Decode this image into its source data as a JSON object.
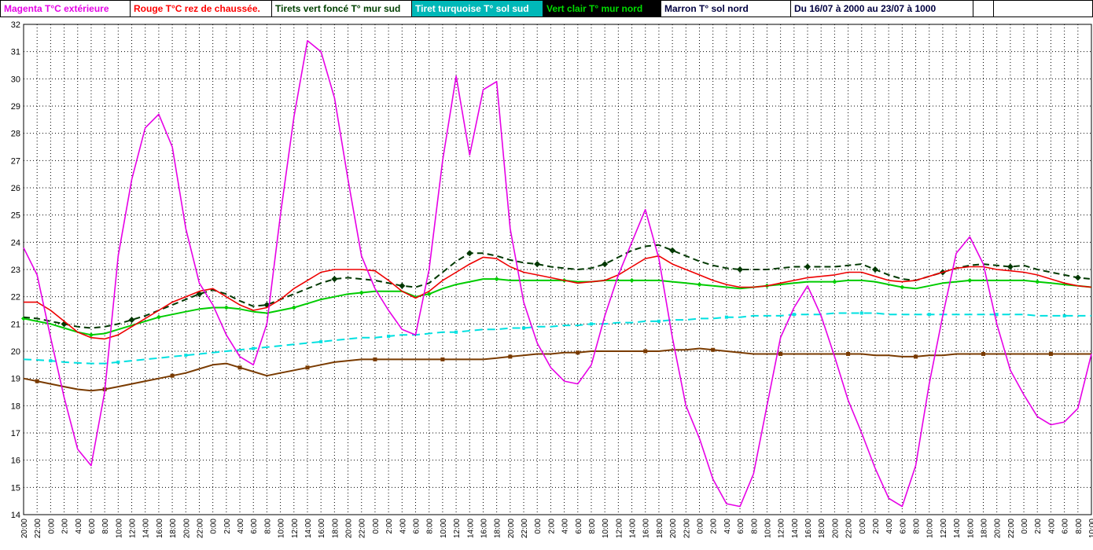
{
  "header": {
    "legend": [
      {
        "label": "Magenta T°C extérieure",
        "color": "#e600e6",
        "bg": "#ffffff"
      },
      {
        "label": "Rouge T°C rez de chaussée.",
        "color": "#ff0000",
        "bg": "#ffffff"
      },
      {
        "label": "Tirets vert foncé T° mur sud",
        "color": "#004000",
        "bg": "#ffffff"
      },
      {
        "label": "Tiret turquoise T° sol sud",
        "color": "#ffffff",
        "bg": "#00b8b8"
      },
      {
        "label": "Vert clair T° mur nord",
        "color": "#00dd00",
        "bg": "#000000"
      },
      {
        "label": "Marron T° sol nord",
        "color": "#000040",
        "bg": "#ffffff"
      }
    ],
    "date_range": "Du 16/07 à 2000 au 23/07 à 1000"
  },
  "chart_data": {
    "type": "line",
    "title": "",
    "xlabel": "",
    "ylabel": "",
    "ylim": [
      14,
      32
    ],
    "y_tick_step": 1,
    "grid": true,
    "plot_bg": "#ffffff",
    "grid_color": "#000000",
    "x_tick_labels": [
      "20:00",
      "22:00",
      "0:00",
      "2:00",
      "4:00",
      "6:00",
      "8:00",
      "10:00",
      "12:00",
      "14:00",
      "16:00",
      "18:00",
      "20:00",
      "22:00",
      "0:00",
      "2:00",
      "4:00",
      "6:00",
      "8:00",
      "10:00",
      "12:00",
      "14:00",
      "16:00",
      "18:00",
      "20:00",
      "22:00",
      "0:00",
      "2:00",
      "4:00",
      "6:00",
      "8:00",
      "10:00",
      "12:00",
      "14:00",
      "16:00",
      "18:00",
      "20:00",
      "22:00",
      "0:00",
      "2:00",
      "4:00",
      "6:00",
      "8:00",
      "10:00",
      "12:00",
      "14:00",
      "16:00",
      "18:00",
      "20:00",
      "22:00",
      "0:00",
      "2:00",
      "4:00",
      "6:00",
      "8:00",
      "10:00",
      "12:00",
      "14:00",
      "16:00",
      "18:00",
      "20:00",
      "22:00",
      "0:00",
      "2:00",
      "4:00",
      "6:00",
      "8:00",
      "10:00",
      "12:00",
      "14:00",
      "16:00",
      "18:00",
      "20:00",
      "22:00",
      "0:00",
      "2:00",
      "4:00",
      "6:00",
      "8:00",
      "10:00"
    ],
    "series": [
      {
        "key": "sol-sud",
        "name": "Tiret turquoise T° sol sud",
        "color": "#00e0e0",
        "width": 2,
        "dash": "10 6",
        "marker": "square",
        "marker_size": 4,
        "marker_every": 5,
        "marker_phase": 2,
        "values": [
          19.7,
          19.68,
          19.65,
          19.6,
          19.57,
          19.55,
          19.55,
          19.6,
          19.65,
          19.7,
          19.75,
          19.8,
          19.85,
          19.9,
          19.95,
          20.0,
          20.05,
          20.1,
          20.15,
          20.2,
          20.25,
          20.3,
          20.35,
          20.4,
          20.45,
          20.5,
          20.5,
          20.55,
          20.6,
          20.6,
          20.65,
          20.7,
          20.7,
          20.75,
          20.8,
          20.8,
          20.85,
          20.85,
          20.9,
          20.9,
          20.95,
          20.95,
          21.0,
          21.0,
          21.05,
          21.05,
          21.1,
          21.1,
          21.15,
          21.15,
          21.2,
          21.2,
          21.25,
          21.25,
          21.3,
          21.3,
          21.3,
          21.35,
          21.35,
          21.35,
          21.4,
          21.4,
          21.4,
          21.4,
          21.35,
          21.35,
          21.35,
          21.35,
          21.35,
          21.35,
          21.35,
          21.35,
          21.35,
          21.35,
          21.35,
          21.3,
          21.3,
          21.3,
          21.3,
          21.3
        ]
      },
      {
        "key": "sol-nord",
        "name": "Marron T° sol nord",
        "color": "#7a3b00",
        "width": 2,
        "dash": null,
        "marker": "square",
        "marker_size": 5,
        "marker_every": 5,
        "marker_phase": 1,
        "values": [
          19.0,
          18.9,
          18.8,
          18.7,
          18.6,
          18.55,
          18.6,
          18.7,
          18.8,
          18.9,
          19.0,
          19.1,
          19.2,
          19.35,
          19.5,
          19.55,
          19.4,
          19.25,
          19.1,
          19.2,
          19.3,
          19.4,
          19.5,
          19.6,
          19.65,
          19.7,
          19.7,
          19.7,
          19.7,
          19.7,
          19.7,
          19.7,
          19.7,
          19.7,
          19.7,
          19.75,
          19.8,
          19.85,
          19.9,
          19.9,
          19.95,
          19.95,
          20.0,
          20.0,
          20.0,
          20.0,
          20.0,
          20.0,
          20.05,
          20.05,
          20.1,
          20.05,
          20.0,
          19.95,
          19.9,
          19.9,
          19.9,
          19.9,
          19.9,
          19.9,
          19.9,
          19.9,
          19.9,
          19.85,
          19.85,
          19.8,
          19.8,
          19.85,
          19.85,
          19.9,
          19.9,
          19.9,
          19.9,
          19.9,
          19.9,
          19.9,
          19.9,
          19.9,
          19.9,
          19.9
        ]
      },
      {
        "key": "mur-nord",
        "name": "Vert clair T° mur nord",
        "color": "#00cc00",
        "width": 2,
        "dash": null,
        "marker": "diamond",
        "marker_size": 3,
        "marker_every": 5,
        "marker_phase": 0,
        "values": [
          21.2,
          21.1,
          21.0,
          20.85,
          20.7,
          20.6,
          20.65,
          20.8,
          20.95,
          21.1,
          21.25,
          21.35,
          21.45,
          21.55,
          21.6,
          21.6,
          21.55,
          21.45,
          21.4,
          21.5,
          21.6,
          21.75,
          21.9,
          22.0,
          22.1,
          22.15,
          22.2,
          22.2,
          22.2,
          22.0,
          22.1,
          22.3,
          22.45,
          22.55,
          22.65,
          22.65,
          22.6,
          22.6,
          22.6,
          22.6,
          22.6,
          22.55,
          22.55,
          22.6,
          22.6,
          22.6,
          22.6,
          22.6,
          22.55,
          22.5,
          22.45,
          22.4,
          22.35,
          22.3,
          22.35,
          22.4,
          22.45,
          22.5,
          22.55,
          22.55,
          22.55,
          22.6,
          22.6,
          22.55,
          22.45,
          22.35,
          22.3,
          22.4,
          22.5,
          22.55,
          22.6,
          22.6,
          22.6,
          22.6,
          22.6,
          22.55,
          22.5,
          22.45,
          22.4,
          22.35
        ]
      },
      {
        "key": "mur-sud",
        "name": "Tirets vert foncé T° mur sud",
        "color": "#003800",
        "width": 2,
        "dash": "8 5",
        "marker": "diamond",
        "marker_size": 4,
        "marker_every": 5,
        "marker_phase": 3,
        "values": [
          21.25,
          21.2,
          21.1,
          21.0,
          20.9,
          20.85,
          20.9,
          21.0,
          21.15,
          21.3,
          21.5,
          21.7,
          21.9,
          22.1,
          22.25,
          22.1,
          21.85,
          21.65,
          21.7,
          21.9,
          22.1,
          22.3,
          22.5,
          22.65,
          22.7,
          22.65,
          22.6,
          22.5,
          22.4,
          22.35,
          22.5,
          22.9,
          23.3,
          23.6,
          23.6,
          23.5,
          23.35,
          23.25,
          23.2,
          23.1,
          23.05,
          23.0,
          23.05,
          23.2,
          23.45,
          23.7,
          23.85,
          23.9,
          23.7,
          23.5,
          23.3,
          23.15,
          23.05,
          23.0,
          23.0,
          23.0,
          23.05,
          23.1,
          23.1,
          23.1,
          23.1,
          23.15,
          23.2,
          23.0,
          22.8,
          22.65,
          22.6,
          22.75,
          22.9,
          23.05,
          23.15,
          23.2,
          23.15,
          23.1,
          23.15,
          23.0,
          22.9,
          22.8,
          22.7,
          22.65
        ]
      },
      {
        "key": "rez-de-chaussee",
        "name": "Rouge T°C rez de chaussée",
        "color": "#ee0000",
        "width": 1.6,
        "dash": null,
        "marker": "none",
        "marker_size": 0,
        "marker_every": 0,
        "marker_phase": 0,
        "values": [
          21.8,
          21.8,
          21.5,
          21.1,
          20.7,
          20.5,
          20.45,
          20.6,
          20.9,
          21.2,
          21.5,
          21.8,
          22.0,
          22.2,
          22.3,
          22.0,
          21.7,
          21.5,
          21.6,
          21.9,
          22.3,
          22.6,
          22.9,
          23.0,
          23.0,
          23.0,
          22.95,
          22.6,
          22.2,
          21.95,
          22.2,
          22.6,
          22.9,
          23.2,
          23.45,
          23.4,
          23.1,
          22.9,
          22.8,
          22.7,
          22.6,
          22.5,
          22.55,
          22.6,
          22.8,
          23.1,
          23.4,
          23.5,
          23.2,
          23.0,
          22.8,
          22.6,
          22.45,
          22.35,
          22.35,
          22.4,
          22.5,
          22.6,
          22.7,
          22.75,
          22.8,
          22.9,
          22.9,
          22.75,
          22.6,
          22.55,
          22.6,
          22.75,
          22.9,
          23.05,
          23.1,
          23.1,
          23.0,
          22.95,
          22.9,
          22.8,
          22.65,
          22.5,
          22.4,
          22.35
        ]
      },
      {
        "key": "exterieure",
        "name": "Magenta T°C extérieure",
        "color": "#e600e6",
        "width": 1.6,
        "dash": null,
        "marker": "none",
        "marker_size": 0,
        "marker_every": 0,
        "marker_phase": 0,
        "values": [
          23.8,
          22.8,
          20.5,
          18.3,
          16.4,
          15.8,
          18.5,
          23.5,
          26.3,
          28.2,
          28.7,
          27.5,
          24.5,
          22.5,
          21.7,
          20.6,
          19.8,
          19.5,
          21.0,
          25.0,
          28.6,
          31.4,
          31.0,
          29.3,
          26.3,
          23.5,
          22.3,
          21.5,
          20.8,
          20.6,
          23.0,
          27.0,
          30.1,
          27.2,
          29.6,
          29.9,
          24.5,
          21.8,
          20.3,
          19.4,
          18.9,
          18.8,
          19.5,
          21.3,
          22.8,
          24.0,
          25.2,
          23.4,
          20.5,
          18.0,
          16.8,
          15.3,
          14.4,
          14.3,
          15.5,
          18.0,
          20.5,
          21.6,
          22.4,
          21.3,
          19.8,
          18.2,
          17.0,
          15.7,
          14.6,
          14.3,
          15.8,
          18.8,
          21.3,
          23.6,
          24.2,
          23.2,
          21.0,
          19.3,
          18.4,
          17.6,
          17.3,
          17.4,
          17.9,
          19.9
        ]
      }
    ]
  }
}
